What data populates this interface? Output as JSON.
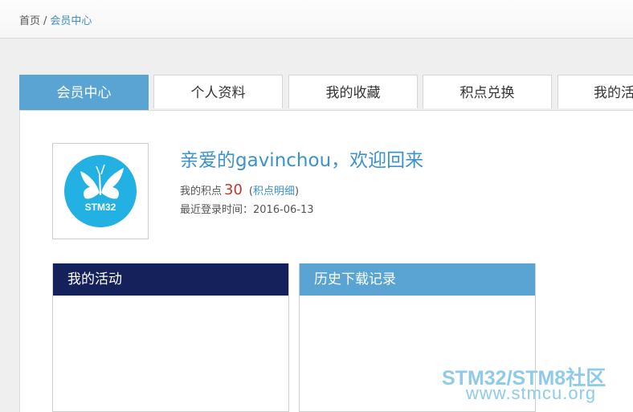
{
  "breadcrumb": {
    "home": "首页",
    "separator": "/",
    "current": "会员中心"
  },
  "tabs": [
    {
      "label": "会员中心",
      "active": true
    },
    {
      "label": "个人资料",
      "active": false
    },
    {
      "label": "我的收藏",
      "active": false
    },
    {
      "label": "积点兑换",
      "active": false
    },
    {
      "label": "我的活动",
      "active": false
    }
  ],
  "profile": {
    "avatar_text": "STM32",
    "welcome": "亲爱的gavinchou，欢迎回来",
    "points_label": "我的积点",
    "points_value": "30",
    "points_link_open": "(",
    "points_link": "积点明细",
    "points_link_close": ")",
    "last_login": "最近登录时间：2016-06-13"
  },
  "boxes": {
    "activity_title": "我的活动",
    "history_title": "历史下载记录"
  },
  "watermark": {
    "line1": "STM32/STM8社区",
    "line2": "www.stmcu.org"
  },
  "colors": {
    "accent": "#5aa4d3",
    "activity_header": "#14215b",
    "avatar_bg": "#23b0e3",
    "points": "#c0392b"
  }
}
